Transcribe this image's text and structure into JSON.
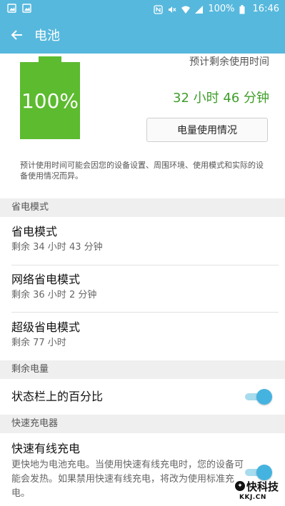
{
  "status_bar": {
    "battery_percent": "100%",
    "time": "16:46",
    "icons": [
      "image-icon",
      "image-icon",
      "nfc-icon",
      "mute-icon",
      "wifi-icon",
      "signal-icon",
      "battery-icon"
    ]
  },
  "app_bar": {
    "title": "电池"
  },
  "battery": {
    "level": 1.0,
    "level_text": "100%",
    "estimate_label": "预计剩余使用时间",
    "estimate_value": "32 小时 46 分钟",
    "usage_button_label": "电量使用情况",
    "disclaimer": "预计使用时间可能会因您的设备设置、周围环境、使用模式和实际的设备使用情况而异。"
  },
  "power_saving": {
    "header": "省电模式",
    "items": [
      {
        "title": "省电模式",
        "subtitle": "剩余 34 小时 43 分钟"
      },
      {
        "title": "网络省电模式",
        "subtitle": "剩余 36 小时 2 分钟"
      },
      {
        "title": "超级省电模式",
        "subtitle": "剩余 77 小时"
      }
    ]
  },
  "remaining": {
    "header": "剩余电量",
    "status_bar_percent_label": "状态栏上的百分比",
    "status_bar_percent_on": true
  },
  "fast_charger": {
    "header": "快速充电器",
    "title": "快速有线充电",
    "description": "更快地为电池充电。当使用快速有线充电时，您的设备可能会发热。如果禁用快速有线充电，将改为使用标准充电。",
    "enabled": true
  },
  "watermark": {
    "main": "快科技",
    "sub": "KKJ.CN"
  },
  "colors": {
    "accent": "#57b8dd",
    "battery_green": "#5cbb2f",
    "estimate_green": "#3f9e2a",
    "toggle_thumb": "#45b3df"
  }
}
